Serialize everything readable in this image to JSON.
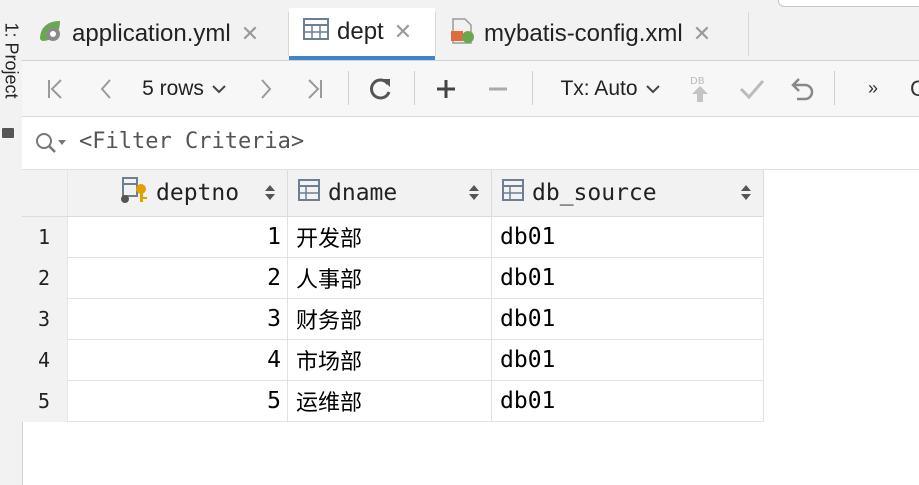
{
  "sidebar": {
    "label": "1: Project",
    "icon": "folder-icon"
  },
  "tabs": [
    {
      "label": "application.yml",
      "icon": "spring-yml-icon",
      "active": false
    },
    {
      "label": "dept",
      "icon": "table-icon",
      "active": true
    },
    {
      "label": "mybatis-config.xml",
      "icon": "xml-file-icon",
      "active": false
    }
  ],
  "toolbar": {
    "first_icon": "first-page-icon",
    "prev_icon": "previous-page-icon",
    "rows_label": "5 rows",
    "next_icon": "next-page-icon",
    "last_icon": "last-page-icon",
    "refresh_icon": "refresh-icon",
    "add_icon": "add-row-icon",
    "remove_icon": "remove-row-icon",
    "tx_label": "Tx: Auto",
    "submit_icon": "db-submit-icon",
    "commit_icon": "commit-check-icon",
    "rollback_icon": "rollback-icon",
    "more_label": "»",
    "overflow_char": "C"
  },
  "filter": {
    "placeholder": "<Filter Criteria>",
    "icon": "search-icon"
  },
  "table": {
    "columns": [
      {
        "name": "deptno",
        "icon": "primary-key-icon"
      },
      {
        "name": "dname",
        "icon": "column-icon"
      },
      {
        "name": "db_source",
        "icon": "column-icon"
      }
    ],
    "rows": [
      {
        "n": "1",
        "deptno": "1",
        "dname": "开发部",
        "db_source": "db01"
      },
      {
        "n": "2",
        "deptno": "2",
        "dname": "人事部",
        "db_source": "db01"
      },
      {
        "n": "3",
        "deptno": "3",
        "dname": "财务部",
        "db_source": "db01"
      },
      {
        "n": "4",
        "deptno": "4",
        "dname": "市场部",
        "db_source": "db01"
      },
      {
        "n": "5",
        "deptno": "5",
        "dname": "运维部",
        "db_source": "db01"
      }
    ]
  }
}
